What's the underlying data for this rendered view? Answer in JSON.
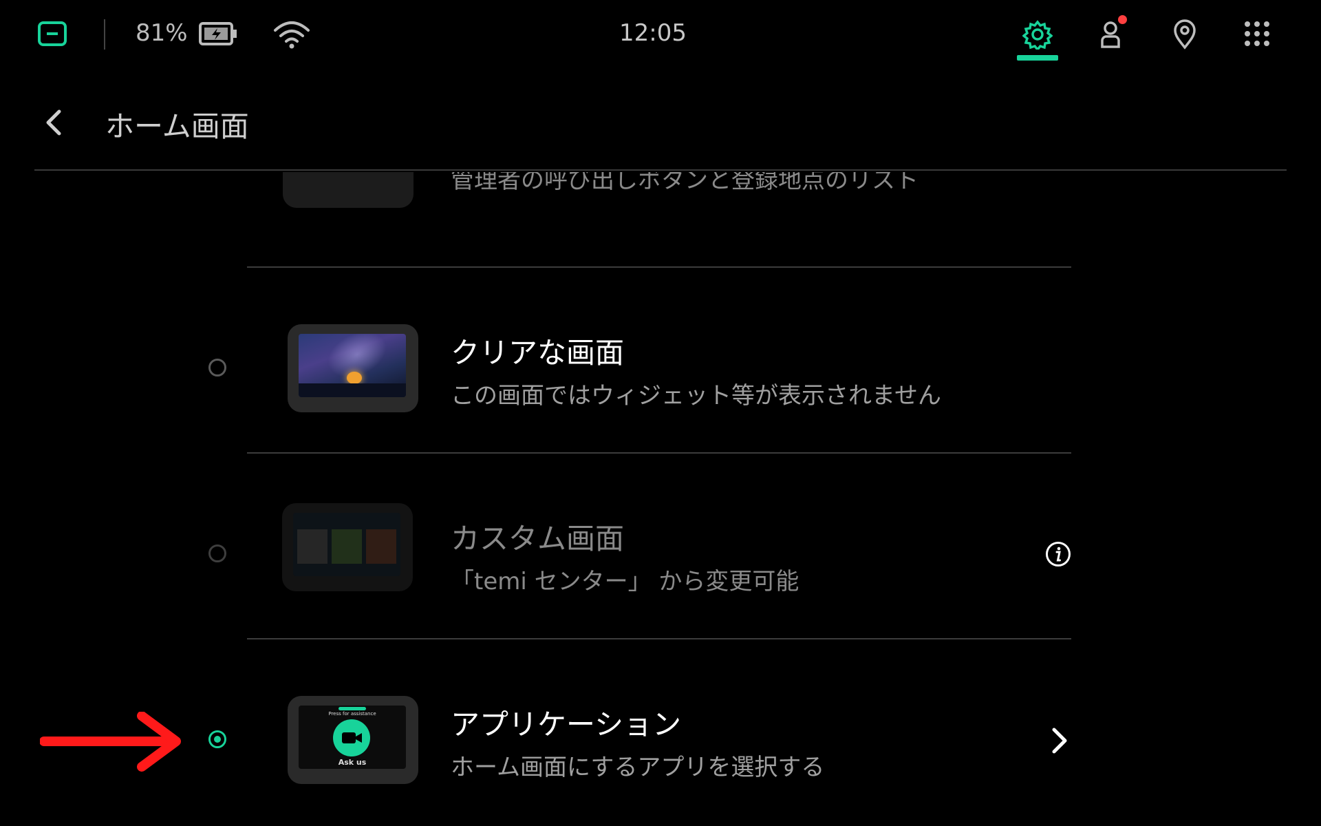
{
  "status": {
    "battery_percent": "81%",
    "time": "12:05"
  },
  "header": {
    "title": "ホーム画面"
  },
  "options": [
    {
      "subtitle": "管理者の呼び出しボタンと登録地点のリスト"
    },
    {
      "title": "クリアな画面",
      "subtitle": "この画面ではウィジェット等が表示されません",
      "selected": false
    },
    {
      "title": "カスタム画面",
      "subtitle": "「temi センター」 から変更可能",
      "selected": false,
      "disabled": true
    },
    {
      "title": "アプリケーション",
      "subtitle": "ホーム画面にするアプリを選択する",
      "selected": true,
      "thumb_text_top": "Press for assistance",
      "thumb_text": "Ask us"
    }
  ],
  "colors": {
    "accent": "#18d39a",
    "arrow": "#ff1a1a",
    "notification": "#ff4040"
  }
}
